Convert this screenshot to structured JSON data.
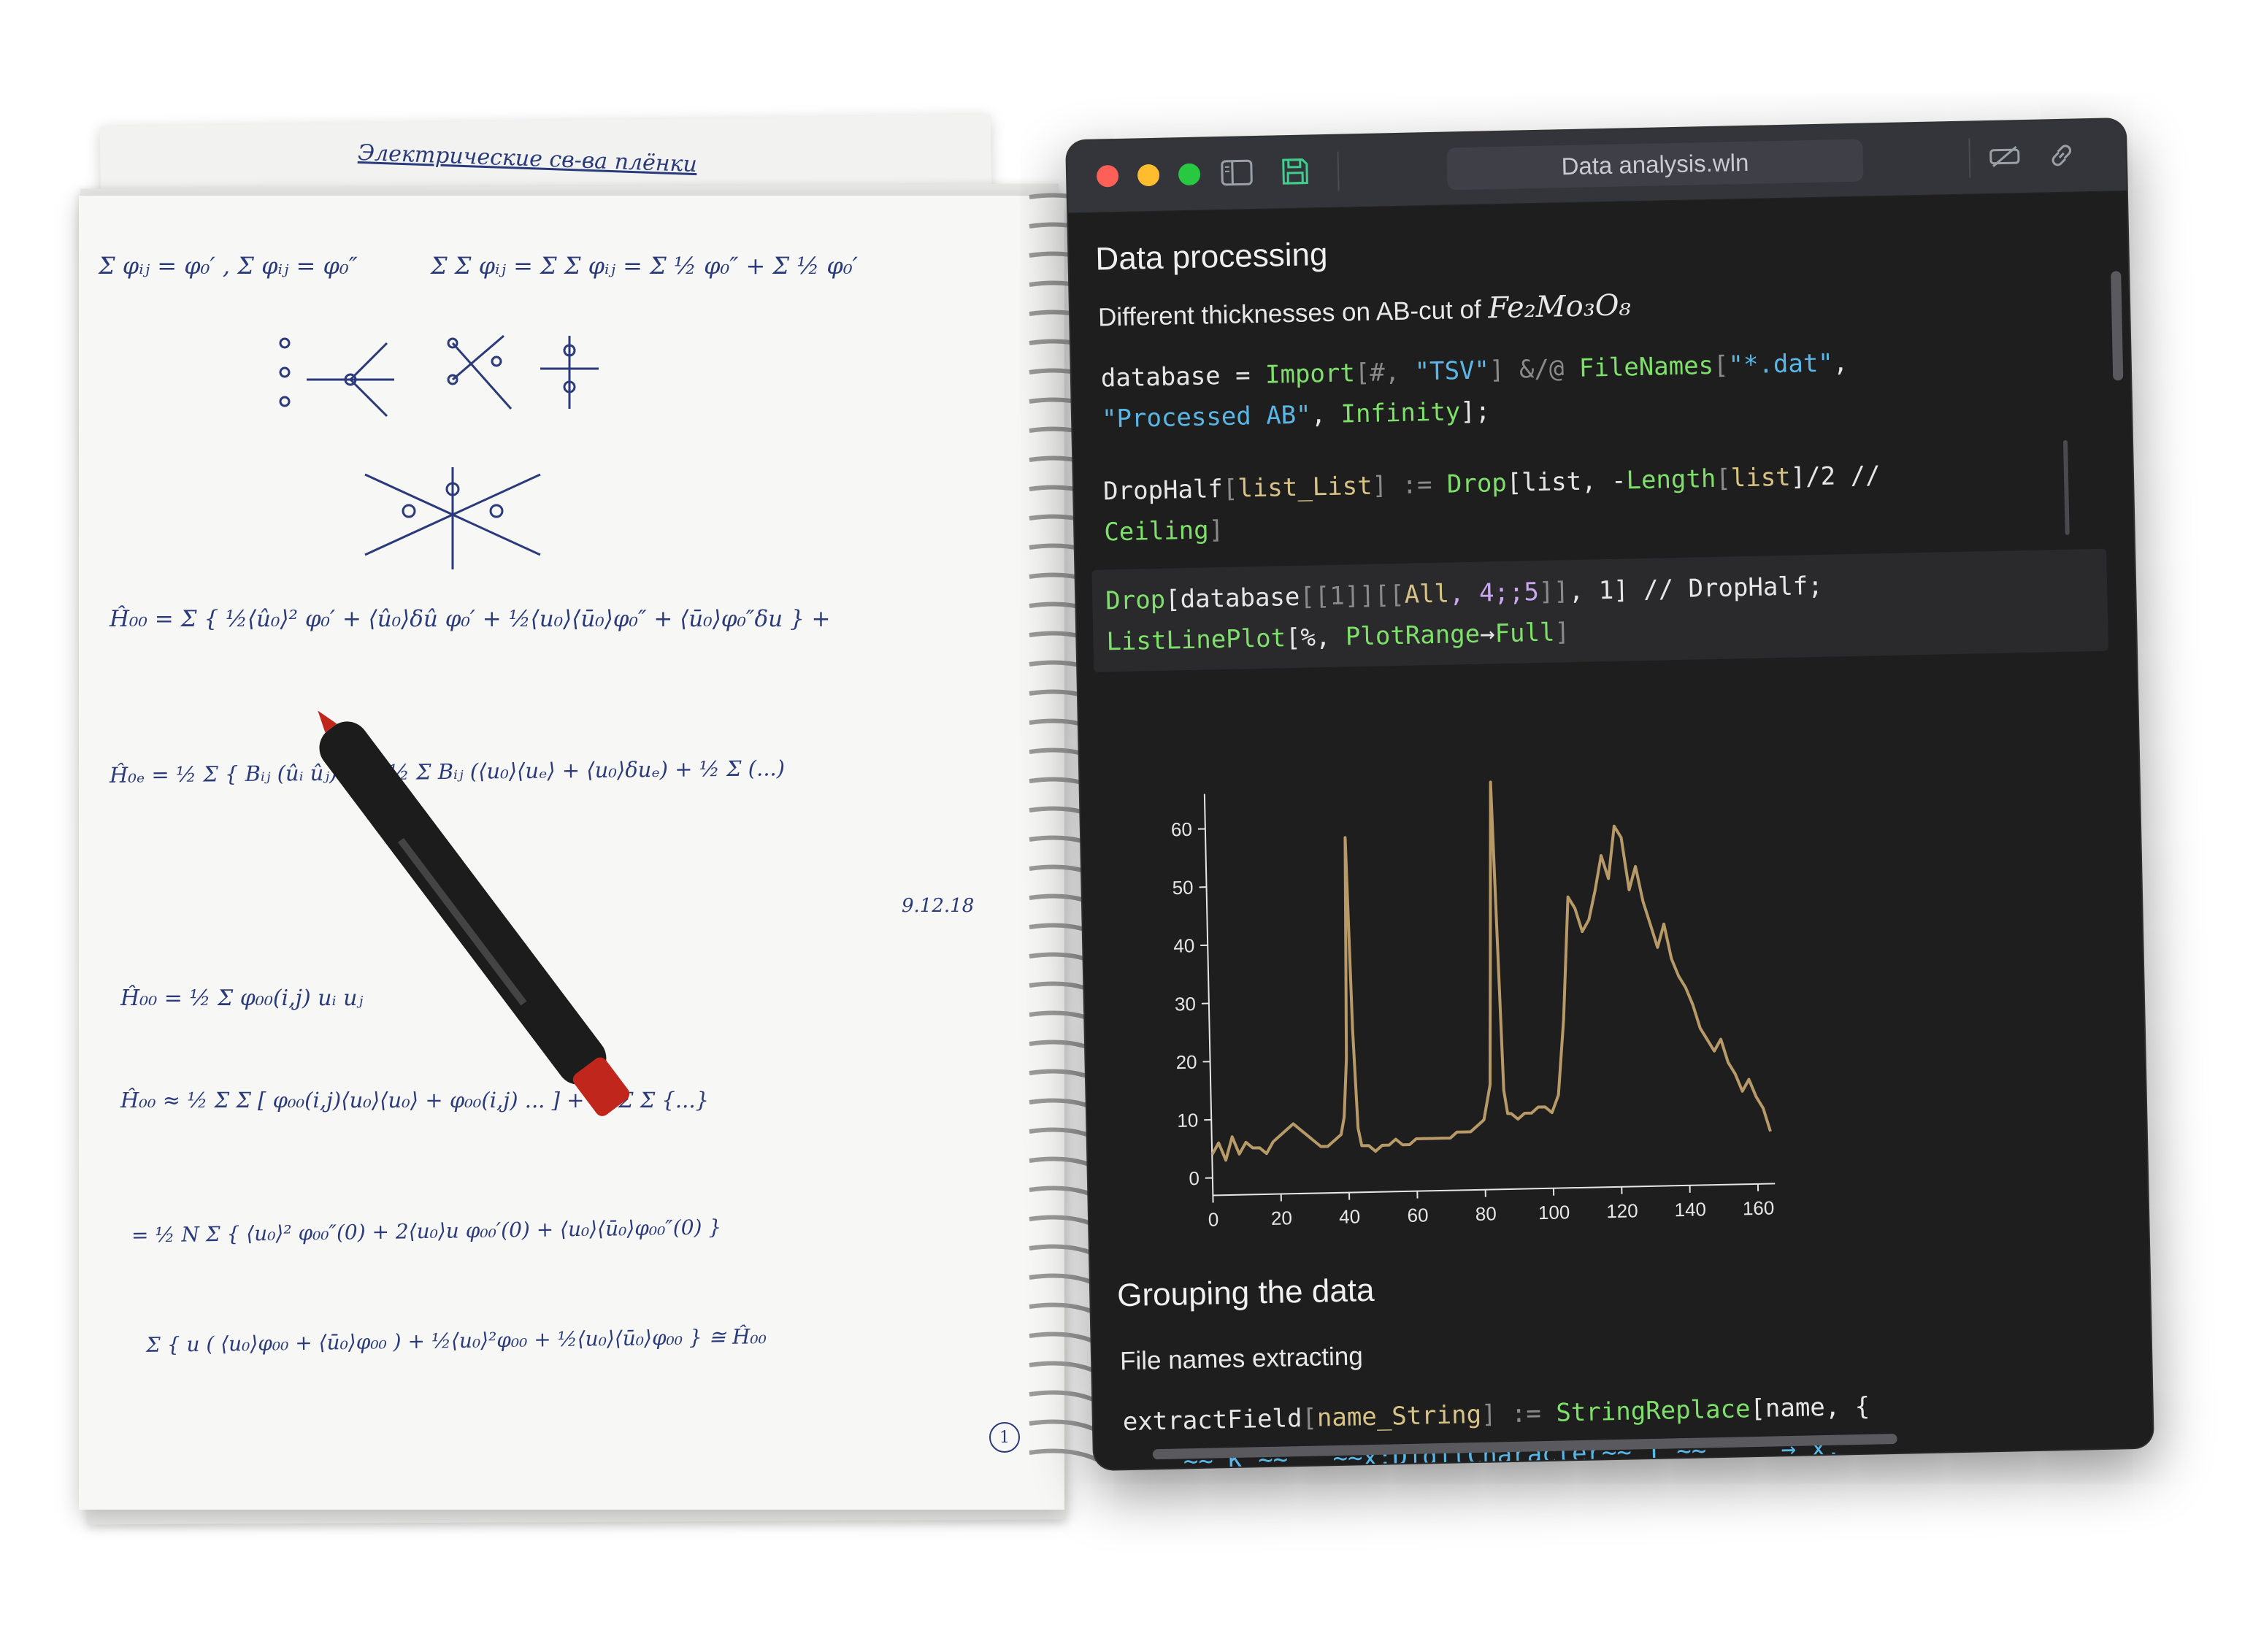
{
  "window": {
    "title": "Data analysis.wln",
    "toolbar_icons": [
      "sidebar-icon",
      "save-icon",
      "unlink-icon",
      "link-icon"
    ]
  },
  "notebook": {
    "section1_title": "Data processing",
    "section1_subtitle_text": "Different thicknesses on AB-cut of",
    "section1_subtitle_formula": "Fe₂Mo₃O₈",
    "code1_line1_a": "database = ",
    "code1_line1_fn1": "Import",
    "code1_line1_b": "[#, ",
    "code1_line1_str1": "\"TSV\"",
    "code1_line1_c": "] &/@ ",
    "code1_line1_fn2": "FileNames",
    "code1_line1_d": "[",
    "code1_line1_str2": "\"*.dat\"",
    "code1_line1_e": ",",
    "code1_line2_str": "\"Processed AB\"",
    "code1_line2_b": ", ",
    "code1_line2_fn": "Infinity",
    "code1_line2_c": "];",
    "code2_line1_a": "DropHalf",
    "code2_line1_b": "[",
    "code2_line1_arg": "list_List",
    "code2_line1_c": "] := ",
    "code2_line1_fn1": "Drop",
    "code2_line1_d": "[list, -",
    "code2_line1_fn2": "Length",
    "code2_line1_e": "[",
    "code2_line1_f": "list",
    "code2_line1_g": "]/2 //",
    "code2_line2_fn": "Ceiling",
    "code2_line2_b": "]",
    "code3_line1_fn": "Drop",
    "code3_line1_a": "[database",
    "code3_line1_b": "[[1]][[",
    "code3_line1_c": "All",
    "code3_line1_d": ", 4;;5",
    "code3_line1_e": "]]",
    "code3_line1_f": ", 1] // DropHalf;",
    "code3_line2_fn1": "ListLinePlot",
    "code3_line2_a": "[%, ",
    "code3_line2_fn2": "PlotRange",
    "code3_line2_b": "→",
    "code3_line2_c": "Full",
    "code3_line2_d": "]",
    "section2_title": "Grouping the data",
    "section2_subtitle": "File names extracting",
    "code4_line1_a": "extractField",
    "code4_line1_b": "[",
    "code4_line1_arg": "name_String",
    "code4_line1_c": "] := ",
    "code4_line1_fn": "StringReplace",
    "code4_line1_d": "[name, {",
    "code4_line2": "    ~~\"K\"~~\" \"~~x:DigitCharacter~~\"T\"~~     → x,"
  },
  "chart_data": {
    "type": "line",
    "title": "",
    "xlabel": "",
    "ylabel": "",
    "xlim": [
      0,
      165
    ],
    "ylim": [
      -3,
      66
    ],
    "x_ticks": [
      "0",
      "20",
      "40",
      "60",
      "80",
      "100",
      "120",
      "140",
      "160"
    ],
    "y_ticks": [
      "0",
      "10",
      "20",
      "30",
      "40",
      "50",
      "60"
    ],
    "line_color": "#b89a68",
    "series": [
      {
        "x": [
          0,
          2,
          4,
          6,
          8,
          10,
          12,
          14,
          16,
          18,
          20,
          22,
          24,
          26,
          28,
          30,
          32,
          34,
          36,
          38,
          39,
          40,
          41,
          42,
          43,
          44,
          46,
          48,
          50,
          52,
          54,
          56,
          58,
          60,
          62,
          64,
          66,
          68,
          70,
          72,
          74,
          76,
          78,
          80,
          82,
          83,
          84,
          85,
          86,
          87,
          88,
          90,
          92,
          94,
          96,
          98,
          100,
          102,
          104,
          106,
          108,
          110,
          112,
          114,
          116,
          118,
          120,
          122,
          124,
          126,
          128,
          130,
          132,
          134,
          136,
          138,
          140,
          142,
          144,
          146,
          148,
          150,
          152,
          154,
          156,
          158,
          160,
          162,
          164
        ],
        "y": [
          4,
          6,
          3,
          7,
          4,
          6,
          5,
          5,
          4,
          6,
          7,
          8,
          9,
          8,
          7,
          6,
          5,
          5,
          6,
          7,
          10,
          20,
          58,
          25,
          8,
          5,
          5,
          4,
          5,
          5,
          6,
          5,
          5,
          6,
          6,
          6,
          6,
          6,
          6,
          7,
          7,
          7,
          8,
          9,
          15,
          40,
          67,
          40,
          14,
          10,
          10,
          9,
          10,
          10,
          11,
          11,
          10,
          13,
          26,
          47,
          45,
          41,
          43,
          48,
          54,
          50,
          59,
          57,
          48,
          52,
          46,
          42,
          38,
          42,
          36,
          33,
          31,
          28,
          24,
          22,
          20,
          22,
          18,
          16,
          13,
          15,
          12,
          10,
          6
        ]
      }
    ]
  },
  "paper": {
    "date_note": "9.12.18",
    "page_number": "1",
    "handwriting": [
      "Электрические св-ва плёнки",
      "Σ φᵢⱼ = φ₀′ ,  Σ φᵢⱼ = φ₀″",
      "Σ Σ φᵢⱼ = Σ Σ φᵢⱼ = Σ ½ φ₀″ + Σ ½ φ₀′",
      "Ĥ₀₀ = Σ { ½⟨û₀⟩² φ₀′ + ⟨û₀⟩δû φ₀′ + ½⟨u₀⟩⟨ū₀⟩φ₀″ + ⟨ū₀⟩φ₀″δu } +",
      "Ĥ₀ₑ = ½ Σ { Bᵢⱼ (ûᵢ ûⱼ) } = ½ Σ Bᵢⱼ (⟨u₀⟩⟨uₑ⟩ + ⟨u₀⟩δuₑ) + ½ Σ (...)",
      "Ĥ₀₀ = ½ Σ φ₀₀(i,j) uᵢ uⱼ",
      "Ĥ₀₀ ≈ ½ Σ Σ [ φ₀₀(i,j)⟨u₀⟩⟨u₀⟩ + φ₀₀(i,j) ... ] + ½ Σ Σ {...}",
      "= ½ N Σ { ⟨u₀⟩² φ₀₀″(0) + 2⟨u₀⟩u φ₀₀′(0) + ⟨u₀⟩⟨ū₀⟩φ₀₀″(0) }",
      "Σ { u ( ⟨u₀⟩φ₀₀ + ⟨ū₀⟩φ₀₀ ) + ½⟨u₀⟩²φ₀₀ + ½⟨u₀⟩⟨ū₀⟩φ₀₀ } ≅ Ĥ₀₀"
    ]
  }
}
